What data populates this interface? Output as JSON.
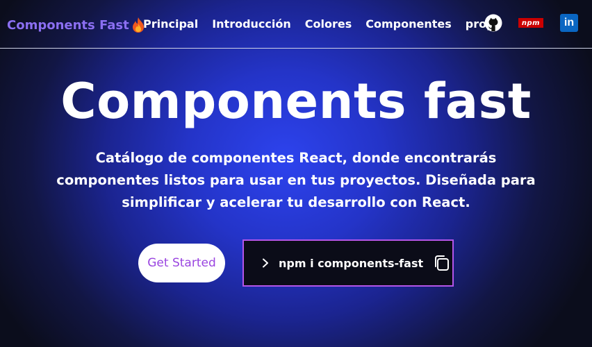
{
  "navbar": {
    "brand": "Components Fast",
    "links": [
      "Principal",
      "Introducción",
      "Colores",
      "Componentes",
      "props"
    ],
    "social": {
      "github": "github-icon",
      "npm": "npm",
      "linkedin": "in"
    }
  },
  "hero": {
    "title": "Components fast",
    "description": "Catálogo de componentes React, donde encontrarás componentes listos para usar en tus proyectos. Diseñada para simplificar y acelerar tu desarrollo con React.",
    "cta_label": "Get Started",
    "install_command": "npm i components-fast"
  },
  "colors": {
    "brand": "#8b6ff2",
    "cta_text": "#9a45e0",
    "command_border": "#b455e8",
    "npm_red": "#cb0000",
    "linkedin_blue": "#0a66c2"
  }
}
